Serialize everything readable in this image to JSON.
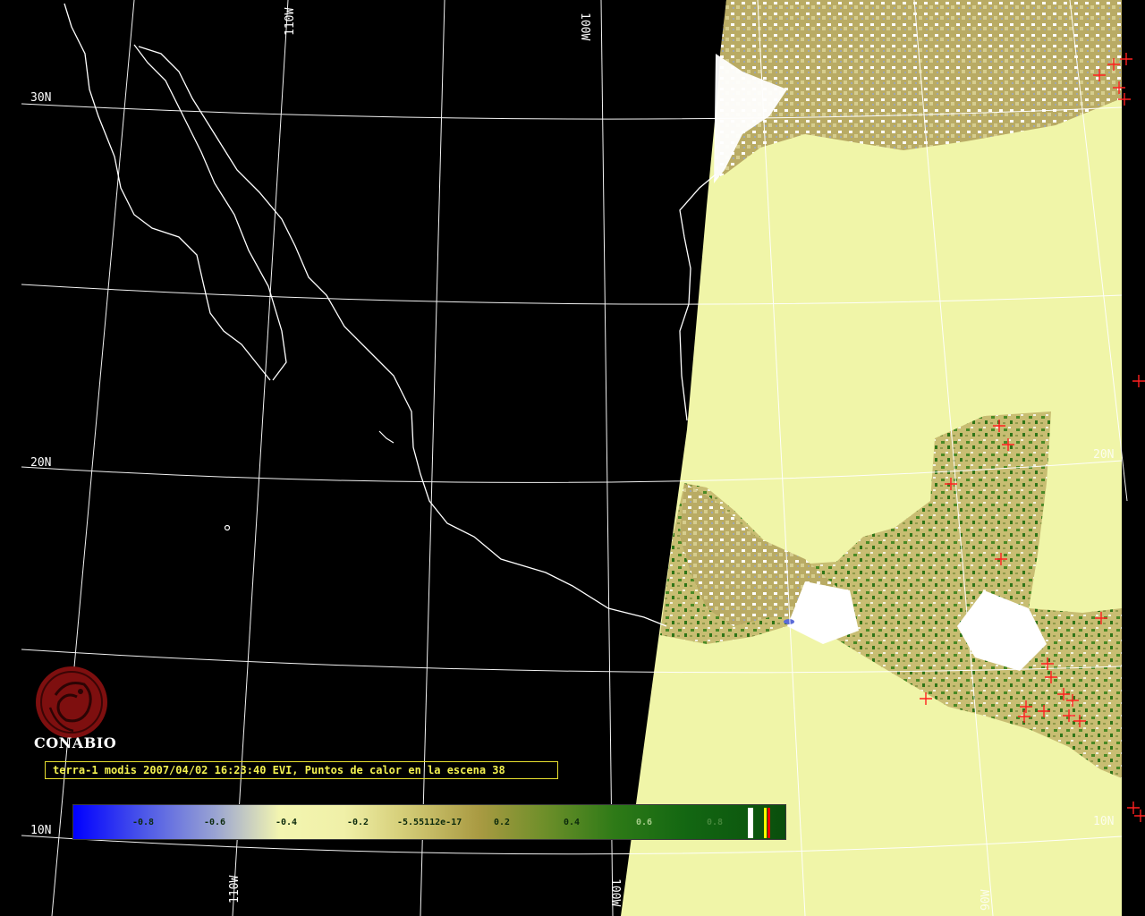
{
  "map": {
    "graticule_labels": {
      "lat_30n": "30N",
      "lat_20n": "20N",
      "lat_20n_east": "20N",
      "lat_10n": "10N",
      "lat_10n_east": "10N",
      "lon_110w_top": "110W",
      "lon_100w_top": "100W",
      "lon_110w_bottom": "110W",
      "lon_100w_bottom": "100W",
      "lon_90w_bottom": "90W"
    },
    "land_color": "#ffffff",
    "water_color": "#f0f5a8",
    "background_color": "#000000",
    "hotspot_color": "#ff2020",
    "hotspot_marker": "plus-icon"
  },
  "branding": {
    "logo_text": "CONABIO",
    "logo_color": "#8a1010",
    "logo_icon": "conabio-seal-icon"
  },
  "caption": {
    "text": "terra-1 modis 2007/04/02 16:23:40 EVI, Puntos de calor en la escena 38",
    "color": "#f2f050"
  },
  "colorbar": {
    "ticks": [
      "-0.8",
      "-0.6",
      "-0.4",
      "-0.2",
      "-5.55112e-17",
      "0.2",
      "0.4",
      "0.6",
      "0.8"
    ],
    "scale_min": -1.0,
    "scale_max": 1.0,
    "end_swatches": [
      "#ffffff",
      "#ffff00",
      "#ff0000"
    ]
  }
}
